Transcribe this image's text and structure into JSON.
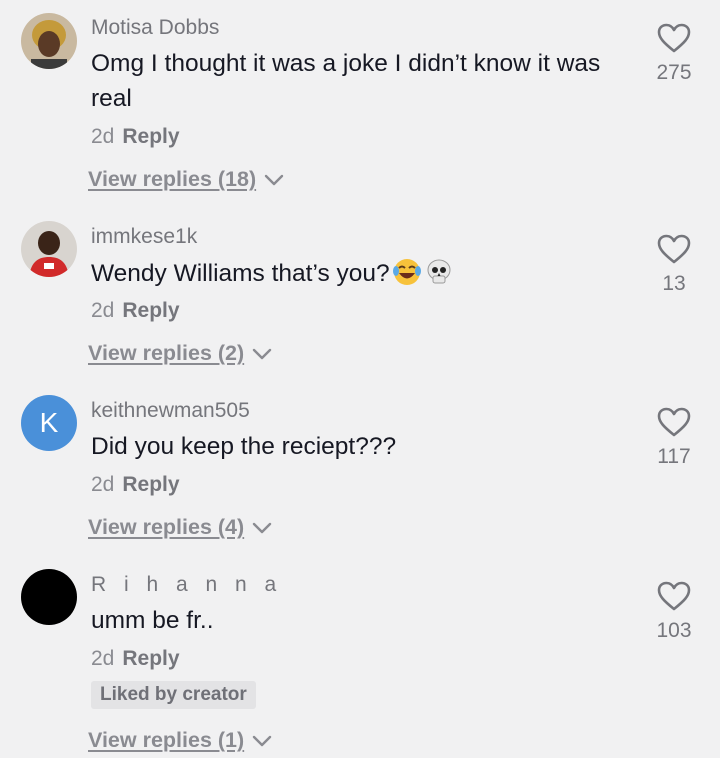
{
  "comments": [
    {
      "username": "Motisa Dobbs",
      "text": "Omg I thought it was a joke I didn’t know it was real",
      "time": "2d",
      "reply_label": "Reply",
      "view_replies": "View replies (18)",
      "likes": "275",
      "avatar_icon": "profile-photo"
    },
    {
      "username": "immkese1k",
      "text": "Wendy Williams that’s you?",
      "emojis": [
        "face-with-tears-of-joy-emoji",
        "skull-emoji"
      ],
      "time": "2d",
      "reply_label": "Reply",
      "view_replies": "View replies (2)",
      "likes": "13",
      "avatar_icon": "profile-photo"
    },
    {
      "username": "keithnewman505",
      "avatar_letter": "K",
      "text": "Did you keep the reciept???",
      "time": "2d",
      "reply_label": "Reply",
      "view_replies": "View replies (4)",
      "likes": "117",
      "avatar_color": "#4a90d9"
    },
    {
      "username": "R i h a n n a",
      "text": "umm be fr..",
      "time": "2d",
      "reply_label": "Reply",
      "liked_by_creator": "Liked by creator",
      "view_replies": "View replies (1)",
      "likes": "103",
      "avatar_color": "#000000"
    }
  ],
  "colors": {
    "background": "#f1f1f2",
    "primary_text": "#161823",
    "secondary_text": "#75767c",
    "badge_bg": "#e3e3e5"
  },
  "icons": [
    "heart-outline-icon",
    "chevron-down-icon"
  ]
}
